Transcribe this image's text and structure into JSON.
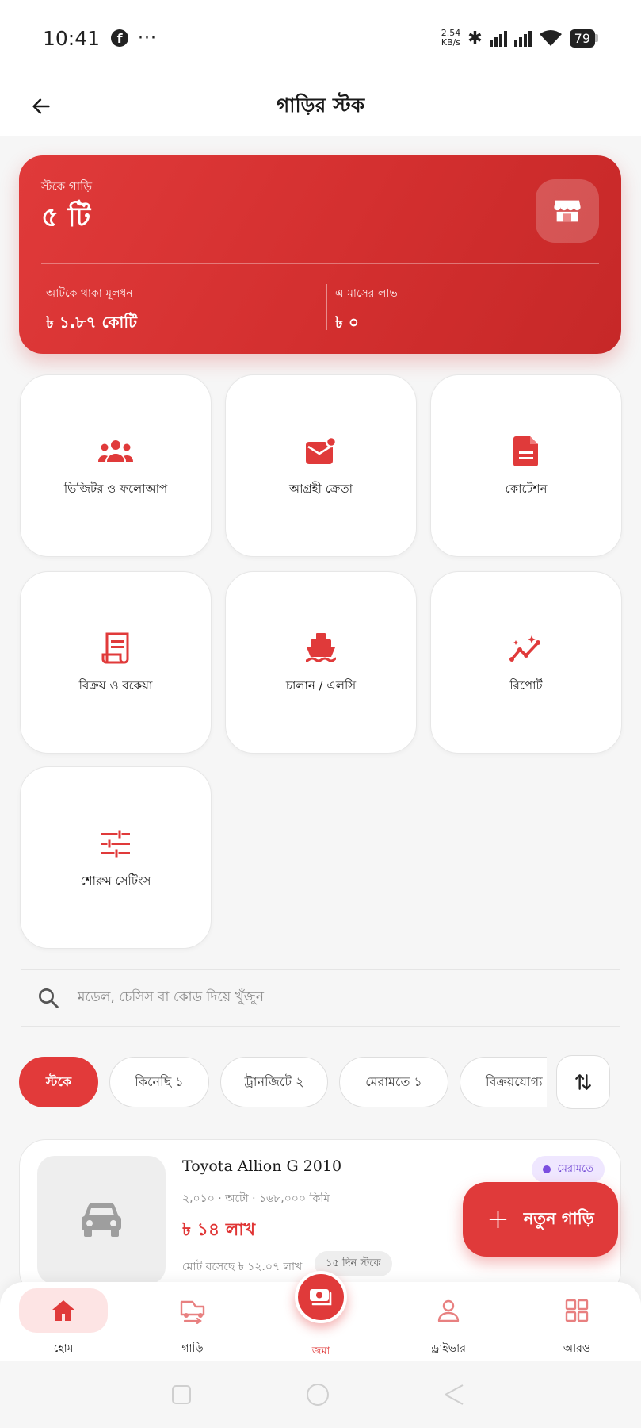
{
  "status_bar": {
    "time": "10:41",
    "net_speed_value": "2.54",
    "net_speed_unit": "KB/s",
    "battery": "79"
  },
  "header": {
    "title": "গাড়ির স্টক"
  },
  "summary": {
    "stock_label": "স্টকে গাড়ি",
    "stock_count": "৫ টি",
    "capital_label": "আটকে থাকা মূলধন",
    "capital_value": "৳ ১.৮৭ কোটি",
    "profit_label": "এ মাসের লাভ",
    "profit_value": "৳ ০"
  },
  "tiles": [
    {
      "label": "ভিজিটর ও ফলোআপ",
      "icon": "users-icon"
    },
    {
      "label": "আগ্রহী ক্রেতা",
      "icon": "mail-badge-icon"
    },
    {
      "label": "কোটেশন",
      "icon": "document-icon"
    },
    {
      "label": "বিক্রয় ও বকেয়া",
      "icon": "receipt-icon"
    },
    {
      "label": "চালান / এলসি",
      "icon": "ship-icon"
    },
    {
      "label": "রিপোর্ট",
      "icon": "insights-icon"
    },
    {
      "label": "শোরুম সেটিংস",
      "icon": "sliders-icon"
    }
  ],
  "search": {
    "placeholder": "মডেল, চেসিস বা কোড দিয়ে খুঁজুন"
  },
  "filters": [
    {
      "label": "স্টকে",
      "active": true
    },
    {
      "label": "কিনেছি ১",
      "active": false
    },
    {
      "label": "ট্রানজিটে ২",
      "active": false
    },
    {
      "label": "মেরামতে ১",
      "active": false
    },
    {
      "label": "বিক্রয়যোগ্য",
      "active": false
    }
  ],
  "car": {
    "title": "Toyota Allion G 2010",
    "meta": "২,০১০ · অটো · ১৬৮,০০০ কিমি",
    "price": "৳ ১৪ লাখ",
    "total": "মোট বসেছে ৳ ১২.০৭ লাখ",
    "days": "১৫ দিন স্টকে",
    "status": "মেরামতে"
  },
  "fab": {
    "label": "নতুন গাড়ি"
  },
  "bottom_nav": {
    "home": "হোম",
    "cars": "গাড়ি",
    "deposit": "জমা",
    "driver": "ড্রাইভার",
    "more": "আরও"
  },
  "colors": {
    "primary": "#e03a3a",
    "status_purple": "#6a3fd1"
  }
}
